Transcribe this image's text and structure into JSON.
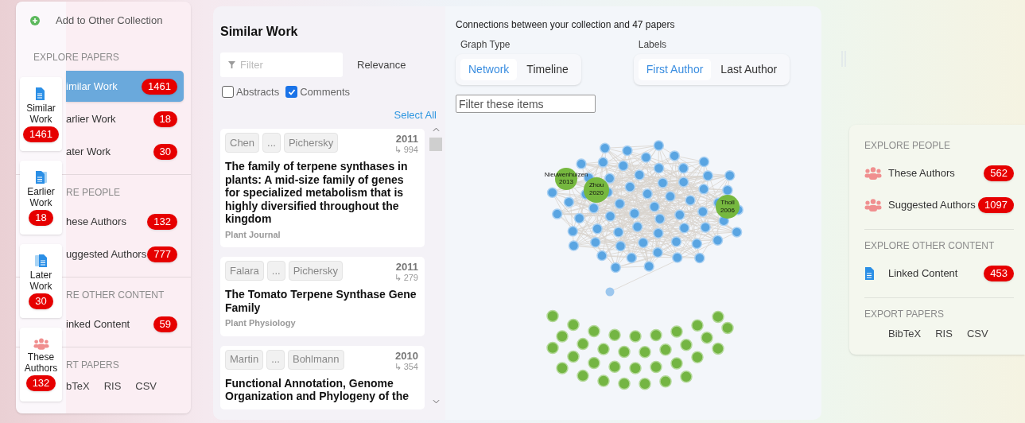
{
  "left_panel": {
    "add_action": "Add to Other Collection",
    "sections": [
      {
        "heading": "EXPLORE PAPERS",
        "items": [
          {
            "label": "imilar Work",
            "count": "1461",
            "selected": true
          },
          {
            "label": "arlier Work",
            "count": "18",
            "selected": false
          },
          {
            "label": "ater Work",
            "count": "30",
            "selected": false
          }
        ]
      },
      {
        "heading": "RE PEOPLE",
        "items": [
          {
            "label": "hese Authors",
            "count": "132",
            "selected": false
          },
          {
            "label": "uggested Authors",
            "count": "777",
            "selected": false
          }
        ]
      },
      {
        "heading": "RE OTHER CONTENT",
        "items": [
          {
            "label": "inked Content",
            "count": "59",
            "selected": false
          }
        ]
      },
      {
        "heading": "RT PAPERS",
        "exports": [
          "bTeX",
          "RIS",
          "CSV"
        ]
      }
    ]
  },
  "quick_cards": [
    {
      "kind": "papers",
      "label": "Similar Work",
      "count": "1461"
    },
    {
      "kind": "earlier",
      "label": "Earlier Work",
      "count": "18"
    },
    {
      "kind": "later",
      "label": "Later Work",
      "count": "30"
    },
    {
      "kind": "people",
      "label": "These Authors",
      "count": "132"
    }
  ],
  "list_panel": {
    "title": "Similar Work",
    "filter": {
      "placeholder": "Filter"
    },
    "sort": "Relevance",
    "options": [
      {
        "label": "Abstracts",
        "checked": false
      },
      {
        "label": "Comments",
        "checked": true
      }
    ],
    "select_all": "Select All",
    "papers": [
      {
        "authors": [
          "Chen",
          "...",
          "Pichersky"
        ],
        "year": "2011",
        "citations": "↳ 994",
        "title": "The family of terpene synthases in plants: A mid-size family of genes for specialized metabolism that is highly diversified throughout the kingdom",
        "journal": "Plant Journal"
      },
      {
        "authors": [
          "Falara",
          "...",
          "Pichersky"
        ],
        "year": "2011",
        "citations": "↳ 279",
        "title": "The Tomato Terpene Synthase Gene Family",
        "journal": "Plant Physiology"
      },
      {
        "authors": [
          "Martin",
          "...",
          "Bohlmann"
        ],
        "year": "2010",
        "citations": "↳ 354",
        "title": "Functional Annotation, Genome Organization and Phylogeny of the"
      }
    ]
  },
  "graph_panel": {
    "caption": "Connections between your collection and 47 papers",
    "graph_type": {
      "label": "Graph Type",
      "options": [
        {
          "label": "Network",
          "selected": true
        },
        {
          "label": "Timeline",
          "selected": false
        }
      ]
    },
    "labels": {
      "label": "Labels",
      "options": [
        {
          "label": "First Author",
          "selected": true
        },
        {
          "label": "Last Author",
          "selected": false
        }
      ]
    },
    "filter": {
      "placeholder": "Filter these items"
    },
    "highlighted_nodes": [
      {
        "name": "Nieuwenhuizen",
        "year": "2013"
      },
      {
        "name": "Zhou",
        "year": "2020"
      },
      {
        "name": "Tholl",
        "year": "2006"
      }
    ]
  },
  "right_panel": {
    "sections": [
      {
        "heading": "EXPLORE PEOPLE",
        "items": [
          {
            "kind": "people",
            "label": "These Authors",
            "count": "562"
          },
          {
            "kind": "people",
            "label": "Suggested Authors",
            "count": "1097"
          }
        ]
      },
      {
        "heading": "EXPLORE OTHER CONTENT",
        "items": [
          {
            "kind": "document",
            "label": "Linked Content",
            "count": "453"
          }
        ]
      },
      {
        "heading": "EXPORT PAPERS",
        "exports": [
          "BibTeX",
          "RIS",
          "CSV"
        ]
      }
    ]
  }
}
